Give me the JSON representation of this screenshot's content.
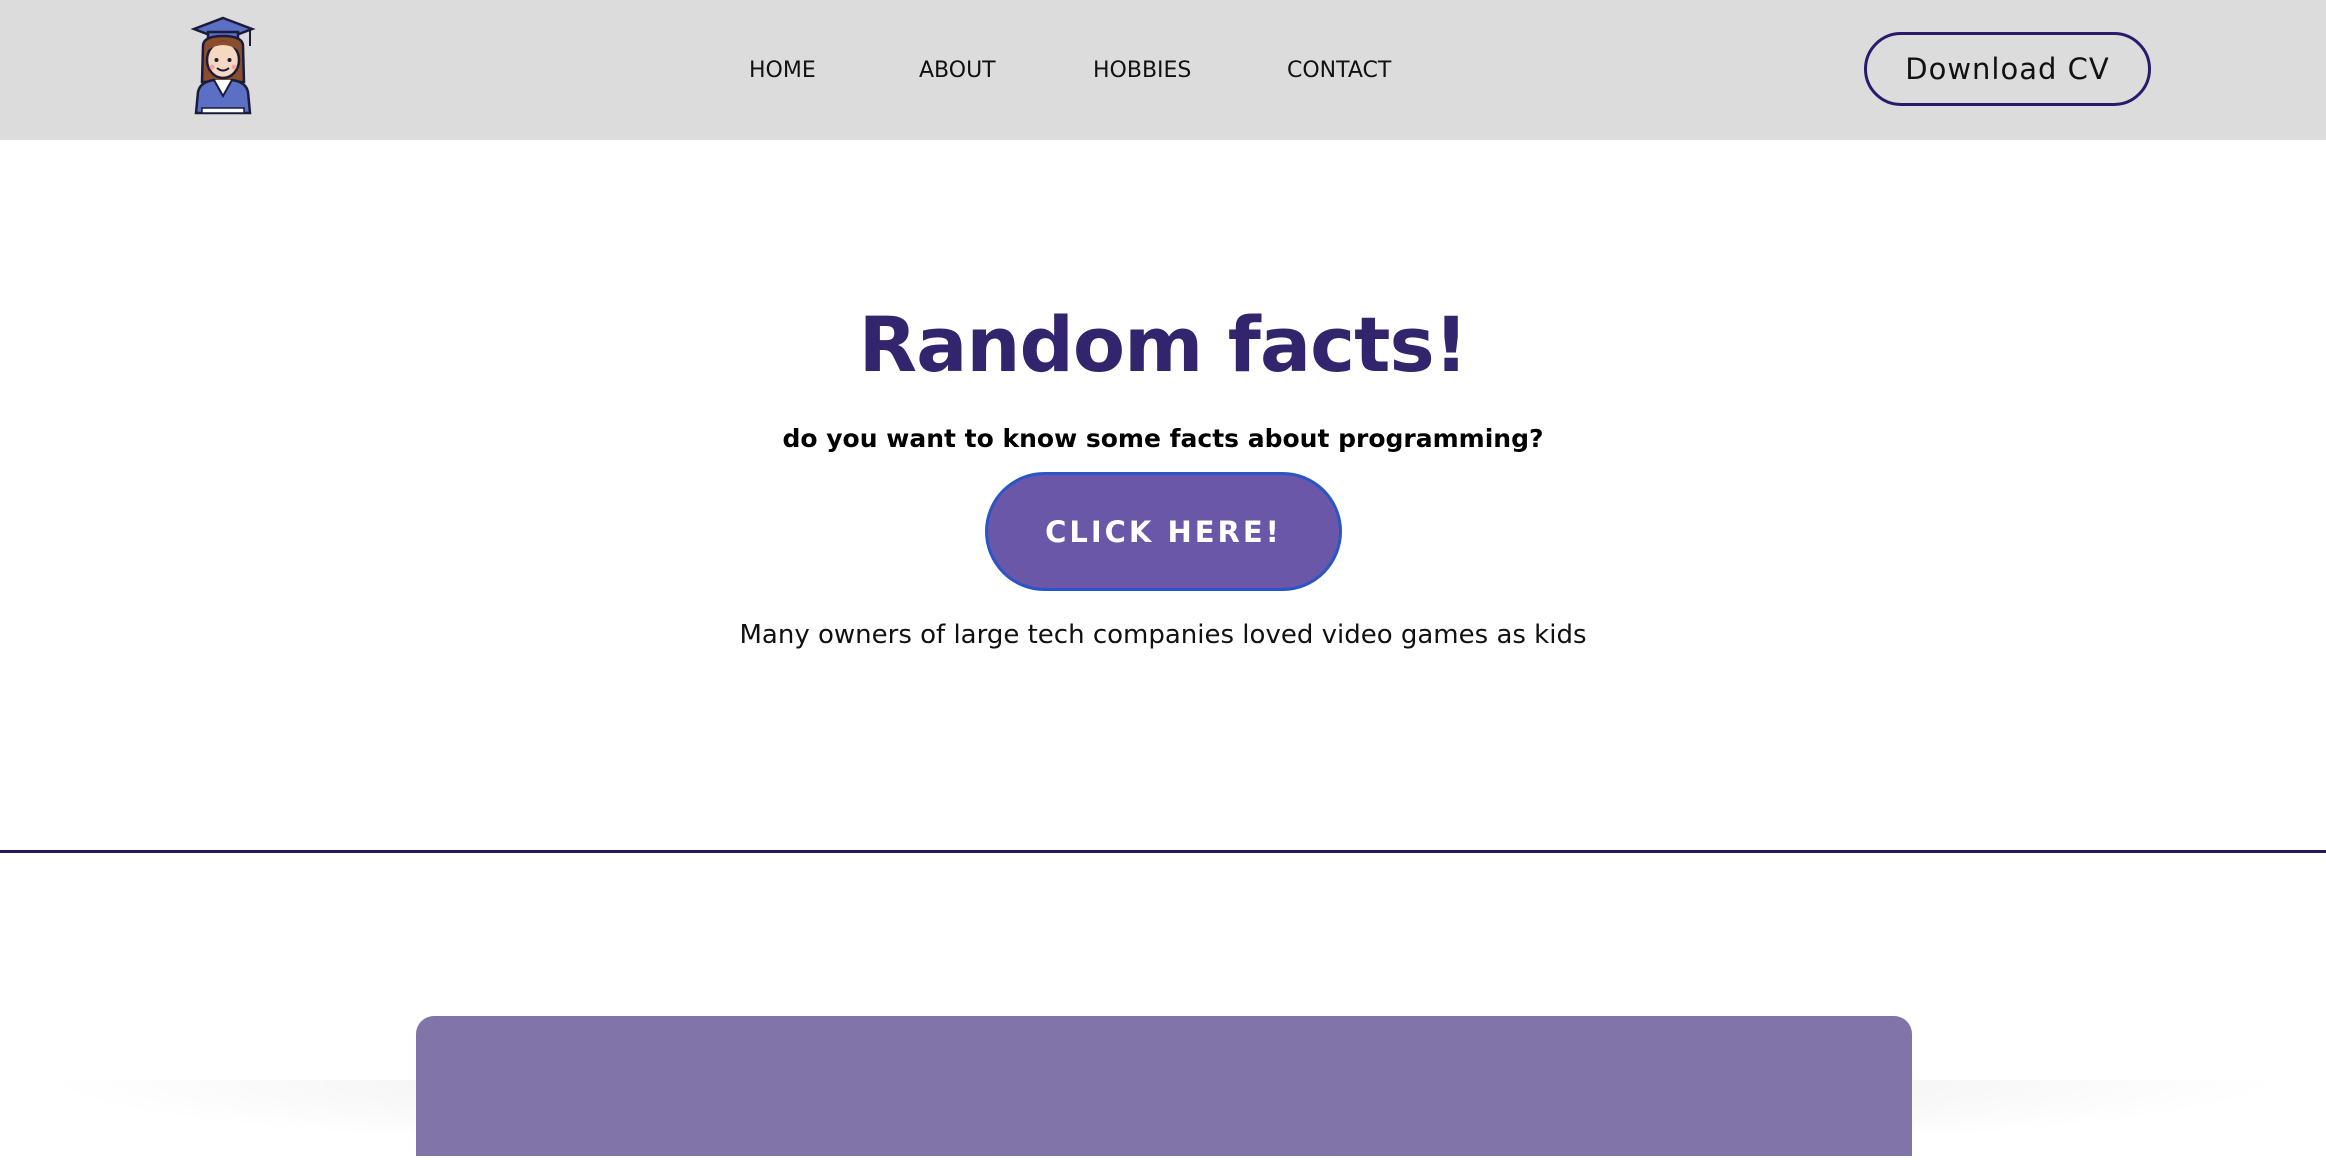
{
  "header": {
    "logo_icon": "graduate-avatar-icon",
    "nav": {
      "home": "HOME",
      "about": "ABOUT",
      "hobbies": "HOBBIES",
      "contact": "CONTACT"
    },
    "cv_button": "Download CV"
  },
  "facts": {
    "title": "Random facts!",
    "subtitle": "do you want to know some facts about programming?",
    "button": "CLICK HERE!",
    "fact_text": "Many owners of large tech companies loved video games as kids"
  },
  "colors": {
    "header_bg": "#dcdcdc",
    "title": "#33246e",
    "button_bg": "#6a57a8",
    "button_border": "#2a55c7",
    "divider": "#221a55",
    "card_bg": "#8174a9"
  }
}
